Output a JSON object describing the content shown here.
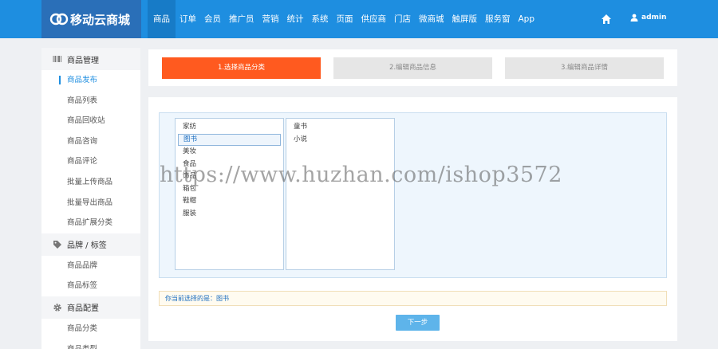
{
  "header": {
    "logo_text": "移动云商城",
    "nav": [
      {
        "label": "商品",
        "active": true
      },
      {
        "label": "订单"
      },
      {
        "label": "会员"
      },
      {
        "label": "推广员"
      },
      {
        "label": "营销"
      },
      {
        "label": "统计"
      },
      {
        "label": "系统"
      },
      {
        "label": "页面"
      },
      {
        "label": "供应商"
      },
      {
        "label": "门店"
      },
      {
        "label": "微商城"
      },
      {
        "label": "触屏版"
      },
      {
        "label": "服务窗"
      },
      {
        "label": "App"
      }
    ],
    "user": "admin"
  },
  "sidebar": {
    "groups": [
      {
        "title": "商品管理",
        "icon": "barcode-icon",
        "items": [
          "商品发布",
          "商品列表",
          "商品回收站",
          "商品咨询",
          "商品评论",
          "批量上传商品",
          "批量导出商品",
          "商品扩展分类"
        ]
      },
      {
        "title": "品牌 / 标签",
        "icon": "tag-icon",
        "items": [
          "商品品牌",
          "商品标签"
        ]
      },
      {
        "title": "商品配置",
        "icon": "gear-icon",
        "items": [
          "商品分类",
          "商品类型"
        ]
      }
    ],
    "active_item": "商品发布"
  },
  "steps": [
    "1.选择商品分类",
    "2.编辑商品信息",
    "3.编辑商品详情"
  ],
  "categories": {
    "level1": [
      "家纺",
      "图书",
      "美妆",
      "食品",
      "饰品",
      "箱包",
      "鞋帽",
      "服装"
    ],
    "level1_selected": "图书",
    "level2": [
      "童书",
      "小说"
    ]
  },
  "selection": {
    "label": "你当前选择的是：",
    "value": "图书"
  },
  "next_button": "下一步",
  "watermark": "https://www.huzhan.com/ishop3572",
  "colors": {
    "header": "#1e8ee0",
    "logo_bg": "#2a6fb8",
    "step_active": "#ff5a1f",
    "button": "#5eb4ea"
  }
}
